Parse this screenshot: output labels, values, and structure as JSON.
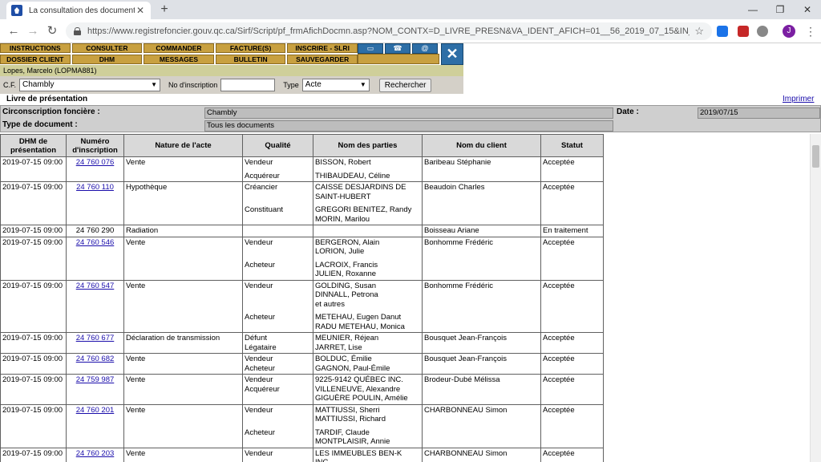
{
  "browser": {
    "tab_title": "La consultation des documents d",
    "url": "https://www.registrefoncier.gouv.qc.ca/Sirf/Script/pf_frmAfichDocmn.asp?NOM_CONTX=D_LIVRE_PRESN&VA_IDENT_AFICH=01__56_2019_07_15&IN_CERTF_NO...",
    "avatar_letter": "J"
  },
  "menu": {
    "row1": [
      "INSTRUCTIONS",
      "CONSULTER",
      "COMMANDER",
      "FACTURE(S)",
      "INSCRIRE - SLRI"
    ],
    "row2": [
      "DOSSIER CLIENT",
      "DHM",
      "MESSAGES",
      "BULLETIN",
      "SAUVEGARDER"
    ]
  },
  "user": "Lopes, Marcelo (LOPMA881)",
  "search": {
    "cf_label": "C.F.",
    "cf_value": "Chambly",
    "no_label": "No d'inscription",
    "type_label": "Type",
    "type_value": "Acte",
    "button": "Rechercher"
  },
  "page_title": "Livre de présentation",
  "print_link": "Imprimer",
  "info": {
    "circ_label": "Circonscription foncière :",
    "circ_value": "Chambly",
    "type_label": "Type de document :",
    "type_value": "Tous les documents",
    "date_label": "Date :",
    "date_value": "2019/07/15"
  },
  "table": {
    "headers": [
      "DHM de présentation",
      "Numéro d'inscription",
      "Nature de l'acte",
      "Qualité",
      "Nom des parties",
      "Nom du client",
      "Statut"
    ],
    "rows": [
      {
        "dhm": "2019-07-15 09:00",
        "num": "24 760 076",
        "link": true,
        "nature": "Vente",
        "parties": [
          {
            "q": "Vendeur",
            "n": [
              "BISSON, Robert"
            ]
          },
          {
            "q": "Acquéreur",
            "n": [
              "THIBAUDEAU, Céline"
            ]
          }
        ],
        "client": "Baribeau Stéphanie",
        "statut": "Acceptée"
      },
      {
        "dhm": "2019-07-15 09:00",
        "num": "24 760 110",
        "link": true,
        "nature": "Hypothèque",
        "parties": [
          {
            "q": "Créancier",
            "n": [
              "CAISSE DESJARDINS DE",
              "SAINT-HUBERT"
            ]
          },
          {
            "q": "Constituant",
            "n": [
              "GREGORI BENITEZ, Randy",
              "MORIN, Marilou"
            ]
          }
        ],
        "client": "Beaudoin Charles",
        "statut": "Acceptée"
      },
      {
        "dhm": "2019-07-15 09:00",
        "num": "24 760 290",
        "link": false,
        "nature": "Radiation",
        "parties": [],
        "client": "Boisseau Ariane",
        "statut": "En traitement"
      },
      {
        "dhm": "2019-07-15 09:00",
        "num": "24 760 546",
        "link": true,
        "nature": "Vente",
        "parties": [
          {
            "q": "Vendeur",
            "n": [
              "BERGERON, Alain",
              "LORION, Julie"
            ]
          },
          {
            "q": "Acheteur",
            "n": [
              "LACROIX, Francis",
              "JULIEN, Roxanne"
            ]
          }
        ],
        "client": "Bonhomme Frédéric",
        "statut": "Acceptée"
      },
      {
        "dhm": "2019-07-15 09:00",
        "num": "24 760 547",
        "link": true,
        "nature": "Vente",
        "parties": [
          {
            "q": "Vendeur",
            "n": [
              "GOLDING, Susan",
              "DINNALL, Petrona",
              "et autres"
            ]
          },
          {
            "q": "Acheteur",
            "n": [
              "METEHAU, Eugen Danut",
              "RADU METEHAU, Monica"
            ]
          }
        ],
        "client": "Bonhomme Frédéric",
        "statut": "Acceptée"
      },
      {
        "dhm": "2019-07-15 09:00",
        "num": "24 760 677",
        "link": true,
        "nature": "Déclaration de transmission",
        "parties": [
          {
            "q": "Défunt",
            "n": [
              "MEUNIER, Réjean"
            ]
          },
          {
            "q": "Légataire",
            "n": [
              "JARRET, Lise"
            ]
          }
        ],
        "client": "Bousquet Jean-François",
        "statut": "Acceptée",
        "tight": true
      },
      {
        "dhm": "2019-07-15 09:00",
        "num": "24 760 682",
        "link": true,
        "nature": "Vente",
        "parties": [
          {
            "q": "Vendeur",
            "n": [
              "BOLDUC, Émilie"
            ]
          },
          {
            "q": "Acheteur",
            "n": [
              "GAGNON, Paul-Émile"
            ]
          }
        ],
        "client": "Bousquet Jean-François",
        "statut": "Acceptée",
        "tight": true
      },
      {
        "dhm": "2019-07-15 09:00",
        "num": "24 759 987",
        "link": true,
        "nature": "Vente",
        "parties": [
          {
            "q": "Vendeur",
            "n": [
              "9225-9142 QUÉBEC INC."
            ]
          },
          {
            "q": "Acquéreur",
            "n": [
              "VILLENEUVE, Alexandre",
              "GIGUÈRE POULIN, Amélie"
            ]
          }
        ],
        "client": "Brodeur-Dubé Mélissa",
        "statut": "Acceptée",
        "tight": true
      },
      {
        "dhm": "2019-07-15 09:00",
        "num": "24 760 201",
        "link": true,
        "nature": "Vente",
        "parties": [
          {
            "q": "Vendeur",
            "n": [
              "MATTIUSSI, Sherri",
              "MATTIUSSI, Richard"
            ]
          },
          {
            "q": "Acheteur",
            "n": [
              "TARDIF, Claude",
              "MONTPLAISIR, Annie"
            ]
          }
        ],
        "client": "CHARBONNEAU Simon",
        "statut": "Acceptée"
      },
      {
        "dhm": "2019-07-15 09:00",
        "num": "24 760 203",
        "link": true,
        "nature": "Vente",
        "parties": [
          {
            "q": "Vendeur",
            "n": [
              "LES IMMEUBLES BEN-K",
              "INC."
            ]
          }
        ],
        "client": "CHARBONNEAU Simon",
        "statut": "Acceptée"
      }
    ]
  }
}
